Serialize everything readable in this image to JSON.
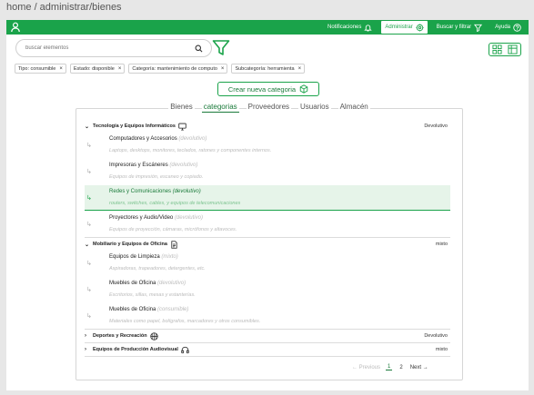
{
  "breadcrumb": "home / administrar/bienes",
  "topbar": {
    "links": [
      {
        "label": "Notificaciones",
        "icon": "bell-icon",
        "active": false
      },
      {
        "label": "Administrar",
        "icon": "gear-icon",
        "active": true
      },
      {
        "label": "Buscar y filtrar",
        "icon": "filter-icon",
        "active": false
      },
      {
        "label": "Ayuda",
        "icon": "help-icon",
        "active": false
      }
    ]
  },
  "search": {
    "placeholder": "buscar elementos"
  },
  "chips": [
    {
      "label": "Tipo: consumible"
    },
    {
      "label": "Estado: disponible"
    },
    {
      "label": "Categoría: mantenimiento de computo"
    },
    {
      "label": "Subcategoría: herramienta"
    }
  ],
  "new_category_label": "Crear nueva categoria",
  "tabs": [
    {
      "label": "Bienes",
      "active": false
    },
    {
      "label": "categorias",
      "active": true
    },
    {
      "label": "Proveedores",
      "active": false
    },
    {
      "label": "Usuarios",
      "active": false
    },
    {
      "label": "Almacén",
      "active": false
    }
  ],
  "groups": [
    {
      "name": "Tecnología y Equipos Informáticos",
      "icon": "monitor-icon",
      "state": "Devolutivo",
      "expanded": true,
      "items": [
        {
          "name": "Computadores y Accesorios",
          "type": "(devolutivo)",
          "desc": "Laptops, desktops, monitores, teclados, ratones y componentes internos.",
          "selected": false
        },
        {
          "name": "Impresoras y Escáneres",
          "type": "(devolutivo)",
          "desc": "Equipos de impresión, escaneo y copiado.",
          "selected": false
        },
        {
          "name": "Redes y Comunicaciones",
          "type": "(devolutivo)",
          "desc": "routers, switches, cables, y equipos de telecomunicaciones",
          "selected": true
        },
        {
          "name": "Proyectores y Audio/Video",
          "type": "(devolutivo)",
          "desc": "Equipos de proyección, cámaras, micrófonos y altavoces.",
          "selected": false
        }
      ]
    },
    {
      "name": "Mobiliario y Equipos de Oficina",
      "icon": "document-icon",
      "state": "mixto",
      "expanded": true,
      "items": [
        {
          "name": "Equipos de Limpieza",
          "type": "(mixto)",
          "desc": "Aspiradoras, trapeadores, detergentes, etc.",
          "selected": false
        },
        {
          "name": "Muebles de Oficina",
          "type": "(devolutivo)",
          "desc": "Escritorios, sillas, mesas y estanterías.",
          "selected": false
        },
        {
          "name": "Muebles de Oficina",
          "type": "(consumible)",
          "desc": "Materiales como papel, bolígrafos, marcadores y otros consumibles.",
          "selected": false
        }
      ]
    },
    {
      "name": "Deportes y Recreación",
      "icon": "ball-icon",
      "state": "Devolutivo",
      "expanded": false,
      "items": []
    },
    {
      "name": "Equipos de Producción Audiovisual",
      "icon": "headphones-icon",
      "state": "mixto",
      "expanded": false,
      "items": []
    }
  ],
  "pager": {
    "prev": "← Previous",
    "pages": [
      "1",
      "2"
    ],
    "current": "1",
    "next": "Next →"
  },
  "colors": {
    "accent": "#1aa34a",
    "selected_bg": "#e6f4e9"
  }
}
